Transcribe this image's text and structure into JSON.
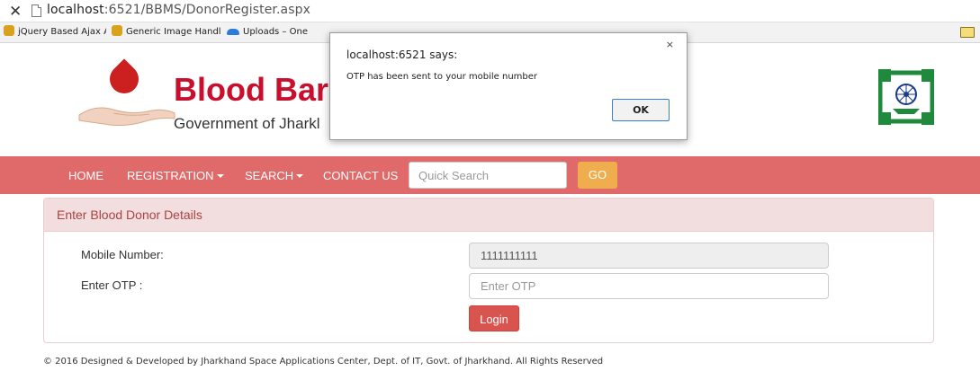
{
  "browser": {
    "url_host": "localhost",
    "url_rest": ":6521/BBMS/DonorRegister.aspx",
    "bookmarks": [
      {
        "label": "jQuery Based Ajax ASI",
        "icon": "app-icon"
      },
      {
        "label": "Generic Image Handle",
        "icon": "app-icon"
      },
      {
        "label": "Uploads – One",
        "icon": "cloud-icon"
      }
    ]
  },
  "header": {
    "title": "Blood Bar",
    "subtitle": "Government of Jharkl"
  },
  "nav": {
    "home": "HOME",
    "registration": "REGISTRATION",
    "search": "SEARCH",
    "contact": "CONTACT US",
    "search_placeholder": "Quick Search",
    "go": "GO"
  },
  "panel": {
    "title": "Enter Blood Donor Details",
    "mobile_label": "Mobile Number:",
    "mobile_value": "1111111111",
    "otp_label": "Enter OTP :",
    "otp_placeholder": "Enter OTP",
    "login": "Login"
  },
  "footer": {
    "text": "© 2016 Designed & Developed by Jharkhand Space Applications Center, Dept. of IT, Govt. of Jharkhand. All Rights Reserved"
  },
  "dialog": {
    "title": "localhost:6521 says:",
    "message": "OTP has been sent to your mobile number",
    "ok": "OK",
    "close": "×"
  },
  "colors": {
    "navbar": "#e06a6a",
    "brand_red": "#c8102e",
    "go_button": "#f0ad4e",
    "login_button": "#d9534f",
    "panel_header": "#f2dede"
  }
}
